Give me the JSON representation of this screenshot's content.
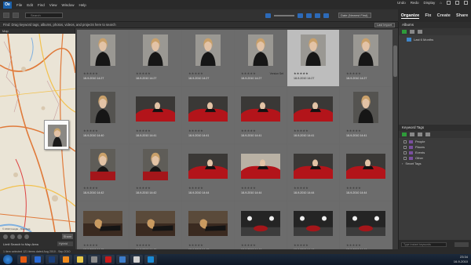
{
  "menubar": {
    "logo": "Oe",
    "items": [
      "File",
      "Edit",
      "Find",
      "View",
      "Window",
      "Help"
    ],
    "undo": "Undo",
    "redo": "Redo",
    "display": "Display"
  },
  "toolbar": {
    "search_placeholder": "Search",
    "sort_value": "Date (Newest First)"
  },
  "modes": [
    "Organize",
    "Fix",
    "Create",
    "Share"
  ],
  "info": {
    "text": "Find: Drag keyword tags, albums, photos, videos, and projects here to search",
    "last_import": "Last Import"
  },
  "map": {
    "header": "Map",
    "share": "Share",
    "local_search": "Limit Search to Map Area",
    "hybrid": "Hybrid",
    "copyright": "© 2010 Google - Map data"
  },
  "photos": [
    {
      "date": "18-9-2010 14:27",
      "stars": "★★★★★",
      "kind": "portrait-bg"
    },
    {
      "date": "18-9-2010 14:27",
      "stars": "★★★★★",
      "kind": "portrait-bg"
    },
    {
      "date": "18-9-2010 14:27",
      "stars": "★★★★★",
      "kind": "portrait-bg"
    },
    {
      "date": "18-9-2010 14:27",
      "stars": "★★★★★",
      "kind": "portrait-bg",
      "badge": "Version Set"
    },
    {
      "date": "18-9-2010 14:27",
      "stars": "★★★★★",
      "kind": "portrait-bg",
      "selected": true
    },
    {
      "date": "18-9-2010 14:27",
      "stars": "★★★★★",
      "kind": "portrait-bg"
    },
    {
      "date": "18-9-2010 14:40",
      "stars": "★★★★★",
      "kind": "portrait-dark"
    },
    {
      "date": "18-9-2010 14:41",
      "stars": "★★★★★",
      "kind": "car"
    },
    {
      "date": "18-9-2010 14:41",
      "stars": "★★★★★",
      "kind": "car"
    },
    {
      "date": "18-9-2010 14:41",
      "stars": "★★★★★",
      "kind": "car"
    },
    {
      "date": "18-9-2010 14:41",
      "stars": "★★★★★",
      "kind": "car"
    },
    {
      "date": "18-9-2010 14:41",
      "stars": "★★★★★",
      "kind": "portrait-dark"
    },
    {
      "date": "18-9-2010 14:42",
      "stars": "★★★★★",
      "kind": "portrait-car"
    },
    {
      "date": "18-9-2010 14:42",
      "stars": "★★★★★",
      "kind": "portrait-car"
    },
    {
      "date": "18-9-2010 14:44",
      "stars": "★★★★★",
      "kind": "car"
    },
    {
      "date": "18-9-2010 14:44",
      "stars": "★★★★★",
      "kind": "car-light"
    },
    {
      "date": "18-9-2010 14:44",
      "stars": "★★★★★",
      "kind": "car"
    },
    {
      "date": "18-9-2010 14:44",
      "stars": "★★★★★",
      "kind": "car"
    },
    {
      "date": "18-9-2010 14:45",
      "stars": "★★★★★",
      "kind": "lying"
    },
    {
      "date": "18-9-2010 14:45",
      "stars": "★★★★★",
      "kind": "lying"
    },
    {
      "date": "18-9-2010 14:45",
      "stars": "★★★★★",
      "kind": "lying"
    },
    {
      "date": "18-9-2010 14:46",
      "stars": "★★★★★",
      "kind": "studio"
    },
    {
      "date": "18-9-2010 14:46",
      "stars": "★★★★★",
      "kind": "studio"
    },
    {
      "date": "18-9-2010 14:46",
      "stars": "★★★★★",
      "kind": "studio"
    }
  ],
  "right": {
    "albums_title": "Albums",
    "album_items": [
      "Last 6 Months"
    ],
    "keywords_title": "Keyword Tags",
    "keyword_items": [
      "People",
      "Places",
      "Events",
      "Other"
    ],
    "smart_tags": "Smart Tags",
    "footer_input": "Type Instant keywords"
  },
  "status": {
    "text": "1 item selected   121 items dated Aug 2010 - Sep 2010"
  },
  "taskbar": {
    "time": "23:34",
    "date": "16-9-2010"
  }
}
